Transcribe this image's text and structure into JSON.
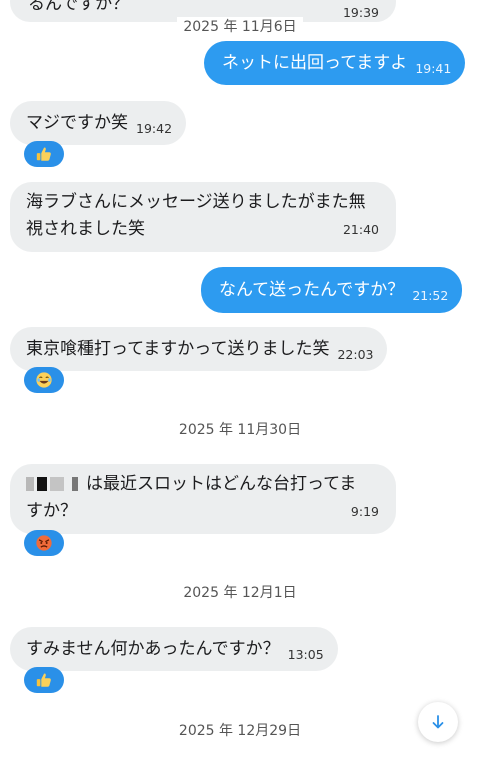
{
  "messages": [
    {
      "text": "るんですか？",
      "time": "19:39"
    },
    {
      "text": "ネットに出回ってますよ",
      "time": "19:41"
    },
    {
      "text": "マジですか笑",
      "time": "19:42"
    },
    {
      "text": "海ラブさんにメッセージ送りましたがまた無",
      "text2": "視されました笑",
      "time": "21:40"
    },
    {
      "text": "なんて送ったんですか？",
      "time": "21:52"
    },
    {
      "text": "東京喰種打ってますかって送りました笑",
      "time": "22:03"
    },
    {
      "text": "は最近スロットはどんな台打ってま",
      "text2": "すか？",
      "time": "9:19"
    },
    {
      "text": "すみません何かあったんですか？",
      "time": "13:05"
    }
  ],
  "dates": [
    "2025 年 11月6日",
    "2025 年 11月30日",
    "2025 年 12月1日",
    "2025 年 12月29日"
  ],
  "reactions": [
    "thumbs-up",
    "laughing-face",
    "angry-face",
    "thumbs-up"
  ],
  "colors": {
    "outgoing": "#2d9bf0",
    "incoming": "#eceeef",
    "reaction_bg": "#2a90e8"
  }
}
